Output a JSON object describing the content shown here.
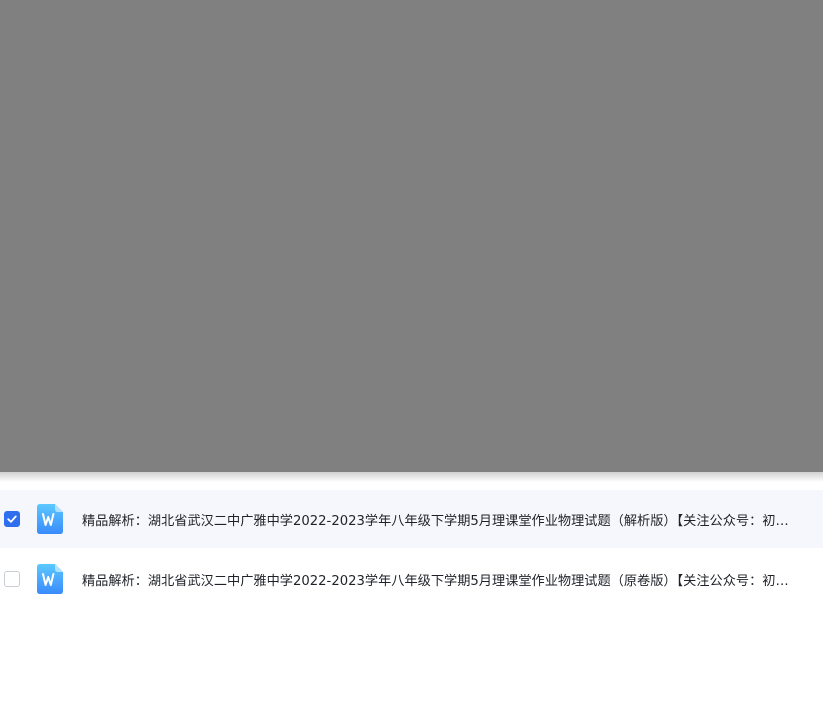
{
  "files": [
    {
      "name": "精品解析：湖北省武汉二中广雅中学2022-2023学年八年级下学期5月理课堂作业物理试题（解析版）【关注公众号：初中速递，获取更多学习资料】",
      "checked": true,
      "icon": "word-doc-icon"
    },
    {
      "name": "精品解析：湖北省武汉二中广雅中学2022-2023学年八年级下学期5月理课堂作业物理试题（原卷版）【关注公众号：初中速递，获取更多学习资料】",
      "checked": false,
      "icon": "word-doc-icon"
    }
  ],
  "colors": {
    "overlay": "#808080",
    "checkbox_checked": "#2f6fed",
    "icon_blue_light": "#5cc8ff",
    "icon_blue_dark": "#3a8bfd",
    "selected_row_bg": "#f5f7fc"
  }
}
